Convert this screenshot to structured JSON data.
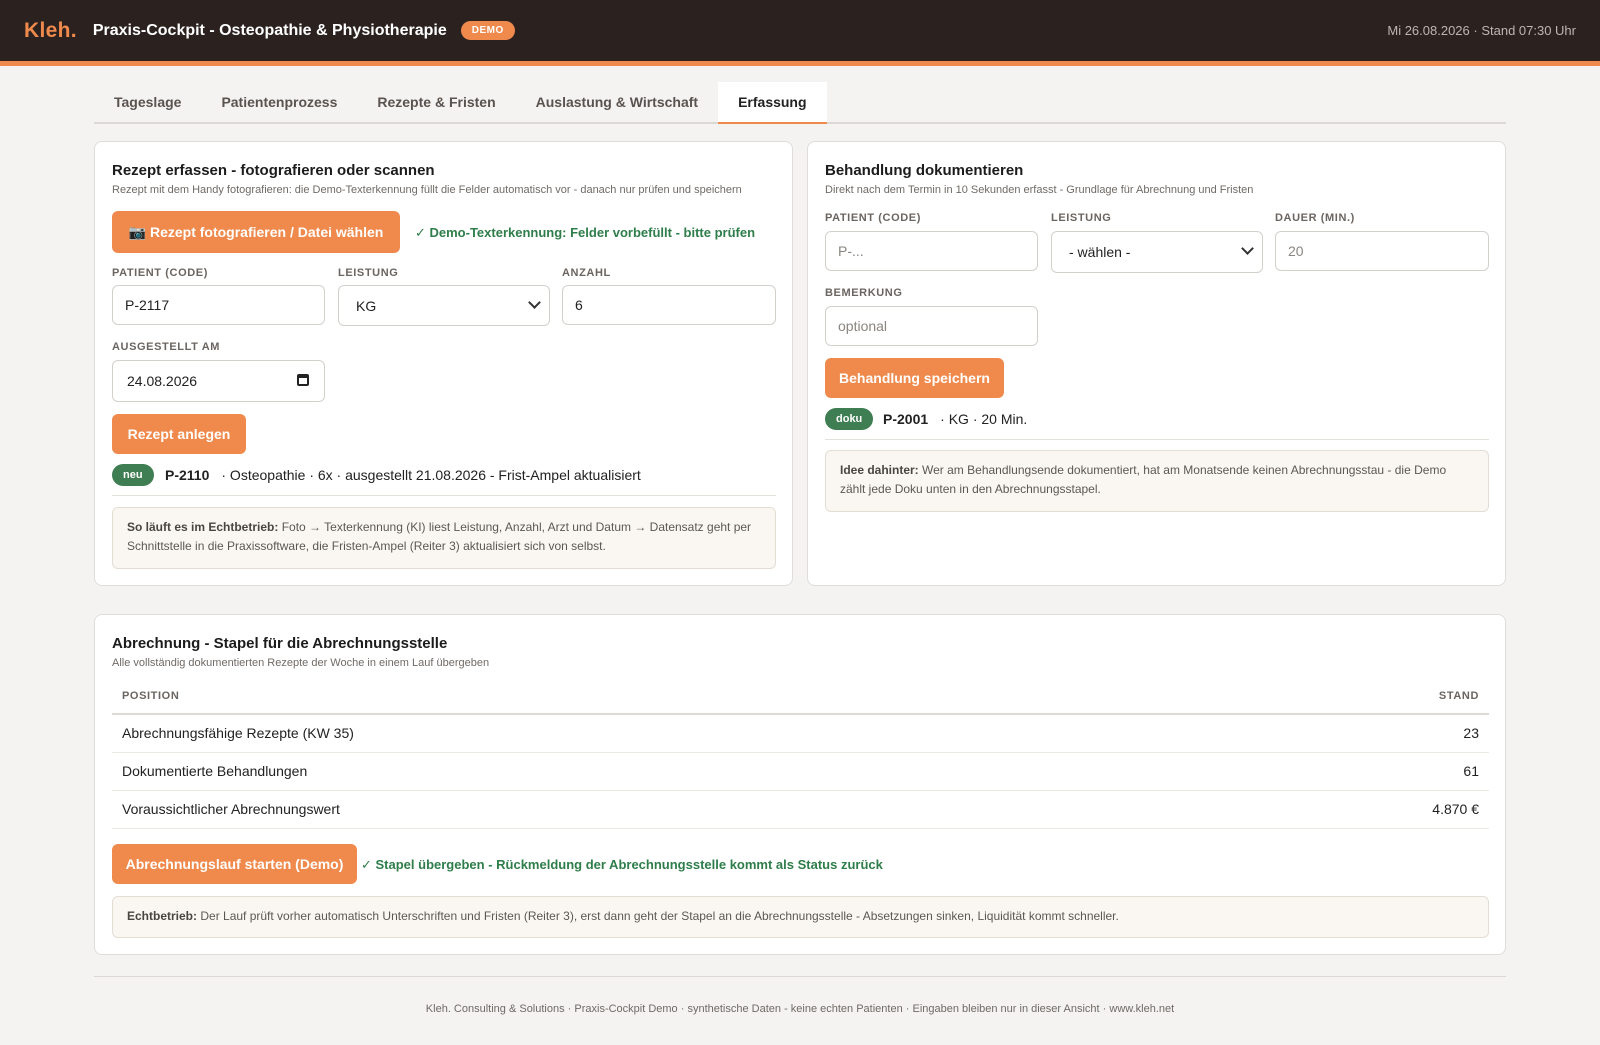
{
  "header": {
    "logo": "Kleh.",
    "title": "Praxis-Cockpit - Osteopathie & Physiotherapie",
    "badge": "DEMO",
    "datetime": "Mi 26.08.2026 · Stand 07:30 Uhr"
  },
  "tabs": [
    {
      "label": "Tageslage"
    },
    {
      "label": "Patientenprozess"
    },
    {
      "label": "Rezepte & Fristen"
    },
    {
      "label": "Auslastung & Wirtschaft"
    },
    {
      "label": "Erfassung",
      "active": true
    }
  ],
  "rezept": {
    "title": "Rezept erfassen - fotografieren oder scannen",
    "subtitle": "Rezept mit dem Handy fotografieren: die Demo-Texterkennung füllt die Felder automatisch vor - danach nur prüfen und speichern",
    "photo_button": "📷 Rezept fotografieren / Datei wählen",
    "ocr_status": "✓ Demo-Texterkennung: Felder vorbefüllt - bitte prüfen",
    "patient_label": "PATIENT (CODE)",
    "patient_value": "P-2117",
    "leistung_label": "LEISTUNG",
    "leistung_value": "KG",
    "anzahl_label": "ANZAHL",
    "anzahl_value": "6",
    "ausgestellt_label": "AUSGESTELLT AM",
    "ausgestellt_value": "24.08.2026",
    "submit_button": "Rezept anlegen",
    "last_badge": "neu",
    "last_code": "P-2110",
    "last_details": "· Osteopathie · 6x · ausgestellt 21.08.2026 - Frist-Ampel aktualisiert",
    "note_bold": "So läuft es im Echtbetrieb:",
    "note_text": " Foto → Texterkennung (KI) liest Leistung, Anzahl, Arzt und Datum → Datensatz geht per Schnittstelle in die Praxissoftware, die Fristen-Ampel (Reiter 3) aktualisiert sich von selbst."
  },
  "behandlung": {
    "title": "Behandlung dokumentieren",
    "subtitle": "Direkt nach dem Termin in 10 Sekunden erfasst - Grundlage für Abrechnung und Fristen",
    "patient_label": "PATIENT (CODE)",
    "patient_placeholder": "P-...",
    "leistung_label": "LEISTUNG",
    "leistung_value": "- wählen -",
    "dauer_label": "DAUER (MIN.)",
    "dauer_placeholder": "20",
    "bemerkung_label": "BEMERKUNG",
    "bemerkung_placeholder": "optional",
    "submit_button": "Behandlung speichern",
    "last_badge": "doku",
    "last_code": "P-2001",
    "last_details": "· KG · 20 Min.",
    "note_bold": "Idee dahinter:",
    "note_text": " Wer am Behandlungsende dokumentiert, hat am Monatsende keinen Abrechnungsstau - die Demo zählt jede Doku unten in den Abrechnungsstapel."
  },
  "abrechnung": {
    "title": "Abrechnung - Stapel für die Abrechnungsstelle",
    "subtitle": "Alle vollständig dokumentierten Rezepte der Woche in einem Lauf übergeben",
    "col_position": "POSITION",
    "col_stand": "STAND",
    "rows": [
      {
        "position": "Abrechnungsfähige Rezepte (KW 35)",
        "stand": "23"
      },
      {
        "position": "Dokumentierte Behandlungen",
        "stand": "61"
      },
      {
        "position": "Voraussichtlicher Abrechnungswert",
        "stand": "4.870 €"
      }
    ],
    "run_button": "Abrechnungslauf starten (Demo)",
    "run_status": "✓ Stapel übergeben - Rückmeldung der Abrechnungsstelle kommt als Status zurück",
    "note_bold": "Echtbetrieb:",
    "note_text": " Der Lauf prüft vorher automatisch Unterschriften und Fristen (Reiter 3), erst dann geht der Stapel an die Abrechnungsstelle - Absetzungen sinken, Liquidität kommt schneller."
  },
  "footer": "Kleh. Consulting & Solutions · Praxis-Cockpit Demo · synthetische Daten - keine echten Patienten · Eingaben bleiben nur in dieser Ansicht · www.kleh.net"
}
